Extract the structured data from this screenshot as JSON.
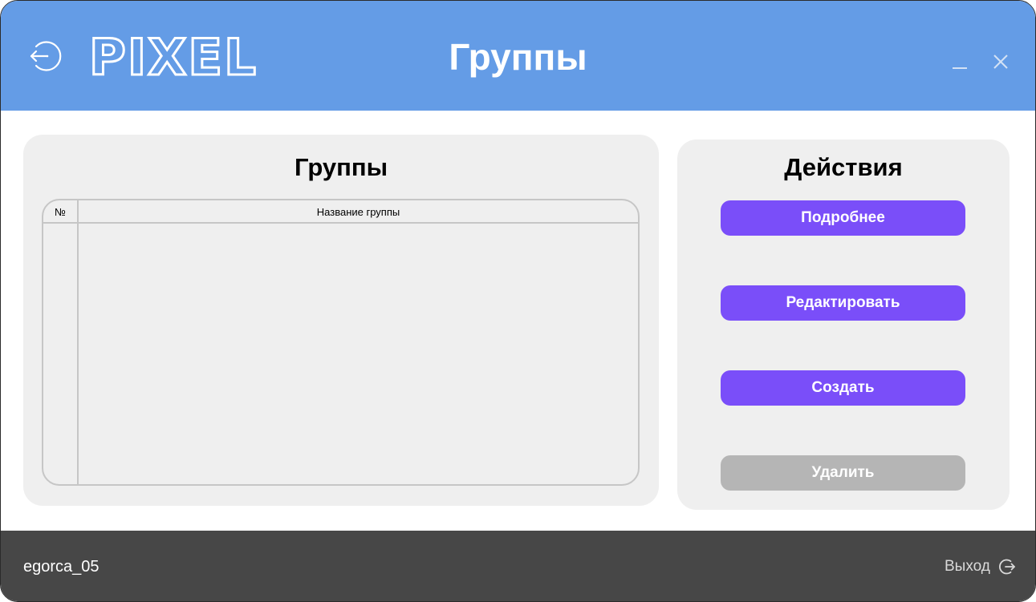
{
  "header": {
    "logo_text": "PIXEL",
    "title": "Группы"
  },
  "icons": {
    "back": "back-arrow-icon",
    "minimize": "minimize-icon",
    "close": "close-icon",
    "logout": "logout-icon"
  },
  "groups_panel": {
    "title": "Группы",
    "table": {
      "columns": [
        "№",
        "Название группы"
      ],
      "rows": []
    }
  },
  "actions_panel": {
    "title": "Действия",
    "buttons": [
      {
        "label": "Подробнее",
        "state": "enabled"
      },
      {
        "label": "Редактировать",
        "state": "enabled"
      },
      {
        "label": "Создать",
        "state": "enabled"
      },
      {
        "label": "Удалить",
        "state": "disabled"
      }
    ]
  },
  "footer": {
    "username": "egorca_05",
    "logout_label": "Выход"
  },
  "colors": {
    "header_bg": "#649ce6",
    "panel_bg": "#efefef",
    "accent_button": "#7a4ef9",
    "disabled_button": "#b5b5b5",
    "footer_bg": "#474747"
  }
}
